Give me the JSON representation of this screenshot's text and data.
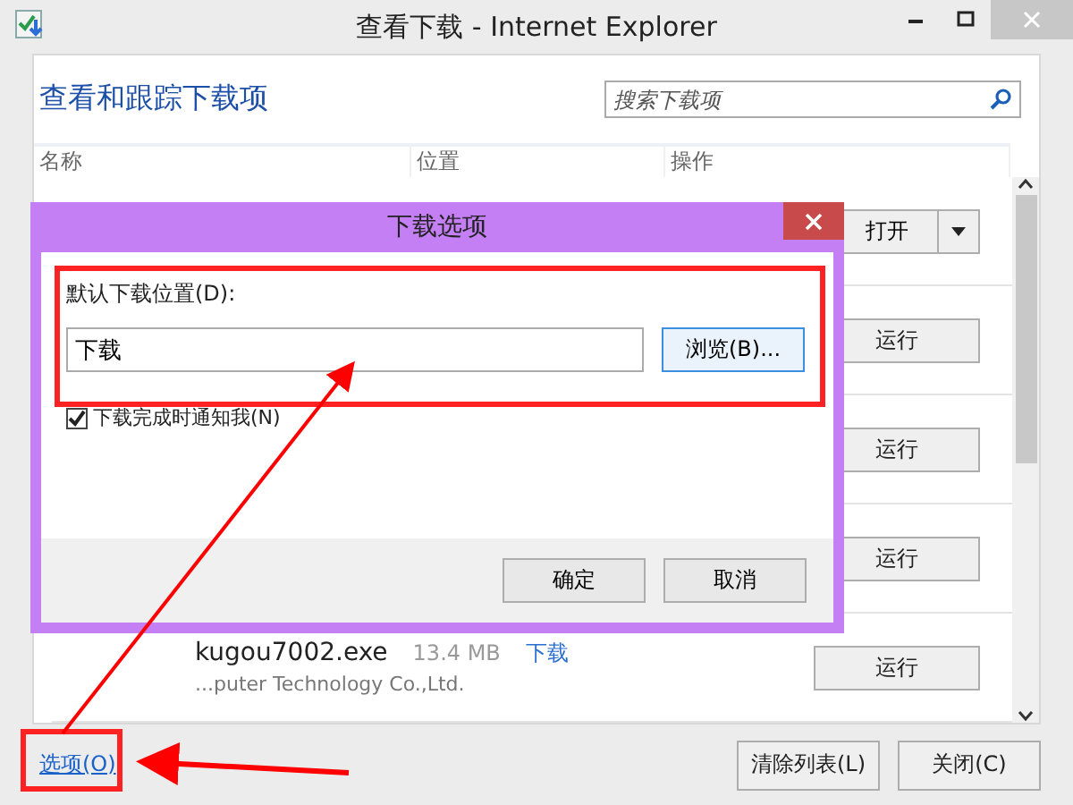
{
  "window": {
    "title": "查看下载 - Internet Explorer"
  },
  "header": {
    "title": "查看和跟踪下载项",
    "search": {
      "placeholder": "搜索下载项"
    }
  },
  "table": {
    "columns": [
      "名称",
      "位置",
      "操作"
    ],
    "rows": [
      {
        "kind": "split",
        "action": "打开"
      },
      {
        "kind": "plain",
        "action": "运行"
      },
      {
        "kind": "plain",
        "action": "运行"
      },
      {
        "kind": "plain",
        "action": "运行"
      },
      {
        "kind": "file",
        "name": "kugou7002.exe",
        "size": "13.4 MB",
        "location": "下载",
        "publisher": "...puter Technology Co.,Ltd.",
        "action": "运行"
      }
    ]
  },
  "footer": {
    "link": "选项(O)",
    "buttons": [
      "清除列表(L)",
      "关闭(C)"
    ]
  },
  "dialog": {
    "title": "下载选项",
    "label": "默认下载位置(D):",
    "value": "下载",
    "browse": "浏览(B)...",
    "notify": {
      "label": "下载完成时通知我(N)",
      "checked": true
    },
    "buttons": [
      "确定",
      "取消"
    ]
  }
}
